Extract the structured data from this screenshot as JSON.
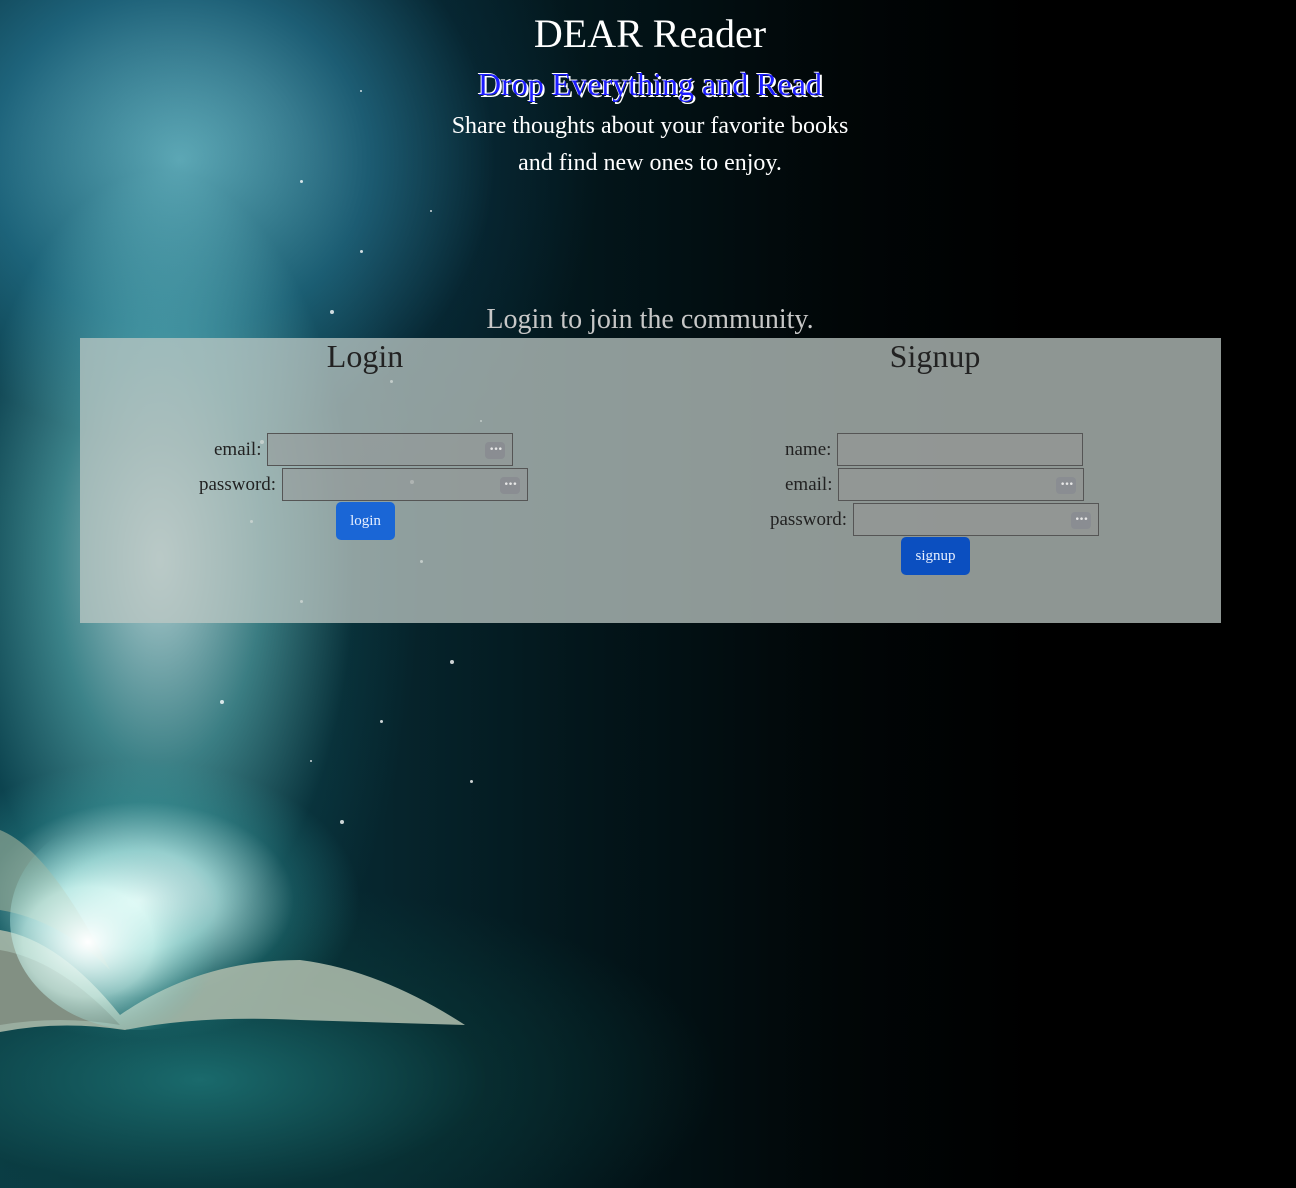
{
  "header": {
    "title": "DEAR Reader",
    "tagline": "Drop Everything and Read",
    "description_line1": "Share thoughts about your favorite books",
    "description_line2": "and find new ones to enjoy."
  },
  "login_prompt": "Login to join the community.",
  "login_form": {
    "title": "Login",
    "email_label": "email:",
    "password_label": "password:",
    "email_value": "",
    "password_value": "",
    "submit_label": "login"
  },
  "signup_form": {
    "title": "Signup",
    "name_label": "name:",
    "email_label": "email:",
    "password_label": "password:",
    "name_value": "",
    "email_value": "",
    "password_value": "",
    "submit_label": "signup"
  },
  "icons": {
    "password_manager_icon": "ellipsis-key-icon"
  },
  "colors": {
    "tagline": "#1c1cff",
    "button": "#1a66d6",
    "panel": "#bec8c4"
  }
}
